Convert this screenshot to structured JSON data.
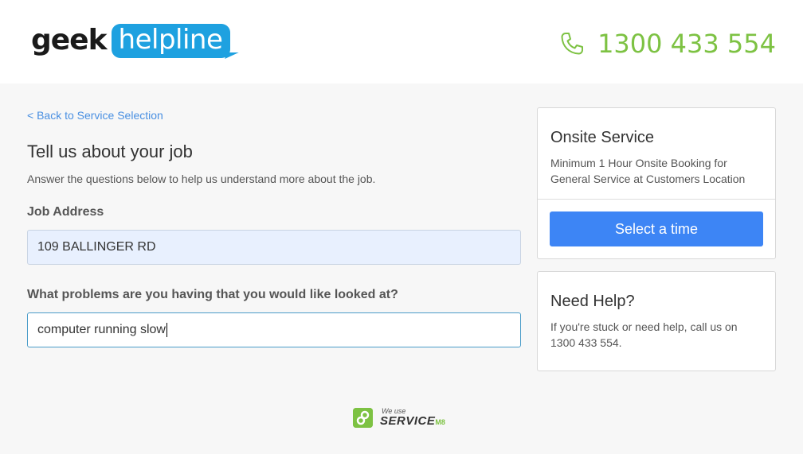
{
  "header": {
    "logo": {
      "part1": "geek",
      "part2": "helpline"
    },
    "phone": {
      "icon": "phone-icon",
      "number": "1300 433 554"
    }
  },
  "main": {
    "back_link": "< Back to Service Selection",
    "title": "Tell us about your job",
    "subtitle": "Answer the questions below to help us understand more about the job.",
    "address": {
      "label": "Job Address",
      "value": "109 BALLINGER RD"
    },
    "problem": {
      "label": "What problems are you having that you would like looked at?",
      "value": "computer running slow"
    }
  },
  "service_card": {
    "title": "Onsite Service",
    "description": "Minimum 1 Hour Onsite Booking for General Service at Customers Location",
    "button_label": "Select a time"
  },
  "help_card": {
    "title": "Need Help?",
    "description": "If you're stuck or need help, call us on 1300 433 554."
  },
  "footer": {
    "we_use": "We use",
    "brand": "SERVICE",
    "brand_suffix": "M8"
  },
  "colors": {
    "brand_blue": "#1ea1e0",
    "phone_green": "#7dc243",
    "button_blue": "#3d85f5",
    "link_blue": "#4a90e2"
  }
}
